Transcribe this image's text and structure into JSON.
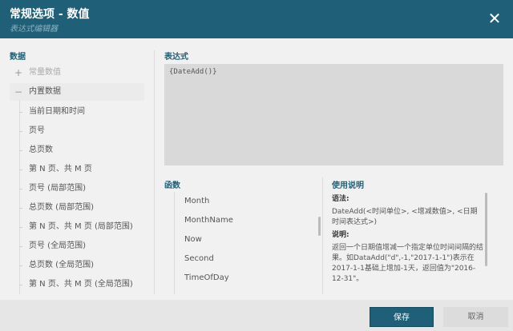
{
  "header": {
    "title": "常规选项 - 数值",
    "subtitle": "表达式编辑器",
    "close_icon": "close-icon"
  },
  "data_panel": {
    "label": "数据",
    "groups": [
      {
        "label": "常量数值",
        "icon": "plus-icon"
      },
      {
        "label": "内置数据",
        "icon": "minus-icon"
      }
    ],
    "items": [
      "当前日期和时间",
      "页号",
      "总页数",
      "第 N 页、共 M 页",
      "页号 (局部范围)",
      "总页数 (局部范围)",
      "第 N 页、共 M 页 (局部范围)",
      "页号 (全局范围)",
      "总页数 (全局范围)",
      "第 N 页、共 M 页 (全局范围)"
    ]
  },
  "expression": {
    "label": "表达式",
    "value": "{DateAdd()}"
  },
  "functions": {
    "label": "函数",
    "items": [
      "Month",
      "MonthName",
      "Now",
      "Second",
      "TimeOfDay"
    ]
  },
  "usage": {
    "label": "使用说明",
    "syntax_label": "语法:",
    "syntax": "DateAdd(<时间单位>, <增减数值>, <日期时间表达式>)",
    "desc_label": "说明:",
    "desc": "返回一个日期值增减一个指定单位时间间隔的结果。如DataAdd(\"d\",-1,\"2017-1-1\")表示在2017-1-1基础上增加-1天，返回值为\"2016-12-31\"。"
  },
  "footer": {
    "save": "保存",
    "cancel": "取消"
  },
  "colors": {
    "accent": "#1f5f78"
  }
}
